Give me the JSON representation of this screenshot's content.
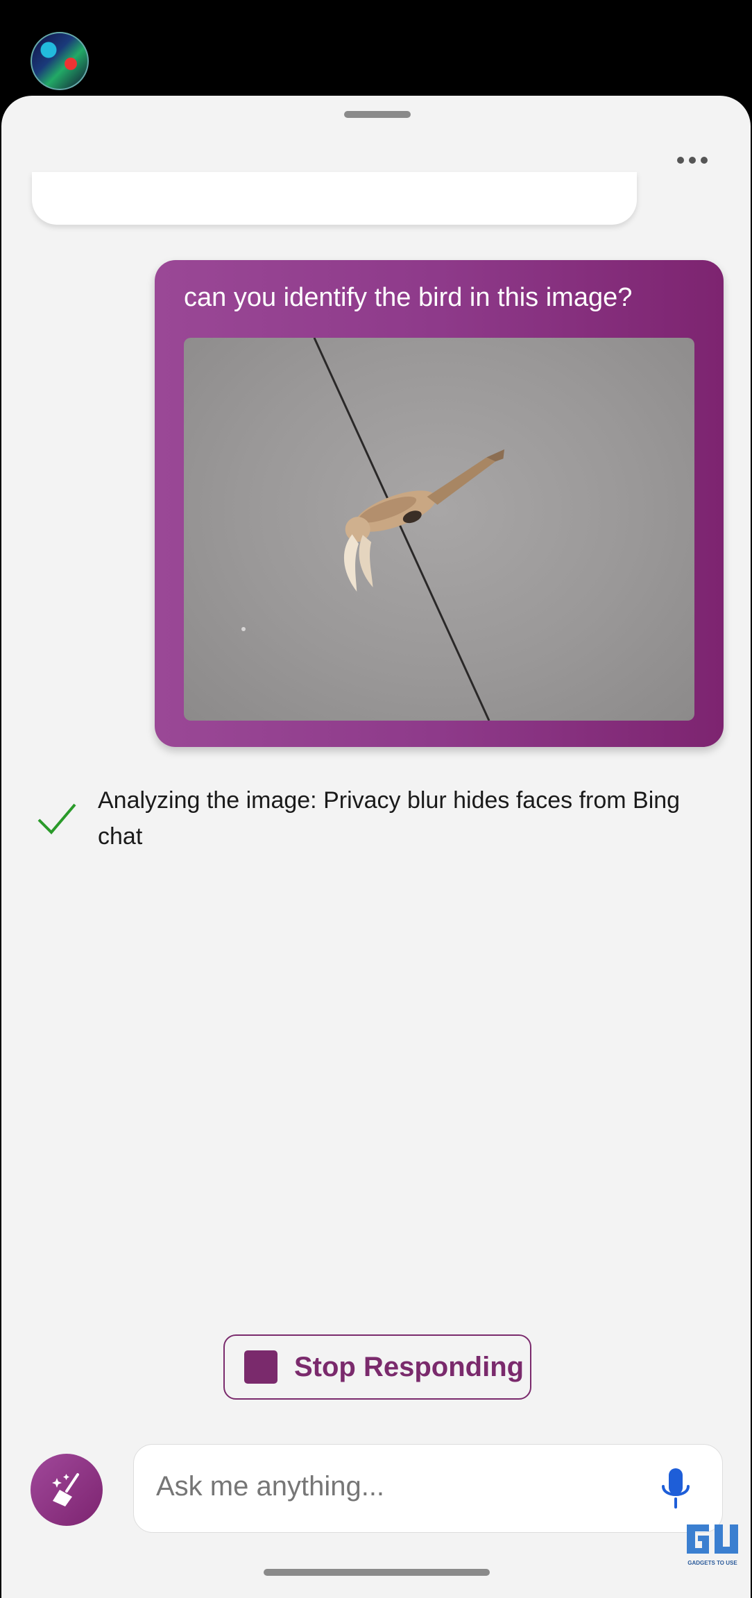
{
  "header": {
    "avatar_icon": "user-avatar",
    "more_icon": "ellipsis-icon"
  },
  "chat": {
    "user_message": "can you identify the bird in this image?",
    "user_image_desc": "bird-on-wire-photo",
    "status_icon": "check-icon",
    "status_text": "Analyzing the image: Privacy blur hides faces from Bing chat"
  },
  "controls": {
    "stop_label": "Stop Responding",
    "new_topic_icon": "broom-sparkle-icon",
    "input_placeholder": "Ask me anything...",
    "mic_icon": "microphone-icon"
  },
  "watermark": {
    "logo": "G U",
    "text": "GADGETS TO USE"
  },
  "colors": {
    "accent": "#7a2a6c",
    "bubble_start": "#9a4896",
    "bubble_end": "#7d2470",
    "check": "#2a9a2a",
    "mic": "#1e5ed8"
  }
}
